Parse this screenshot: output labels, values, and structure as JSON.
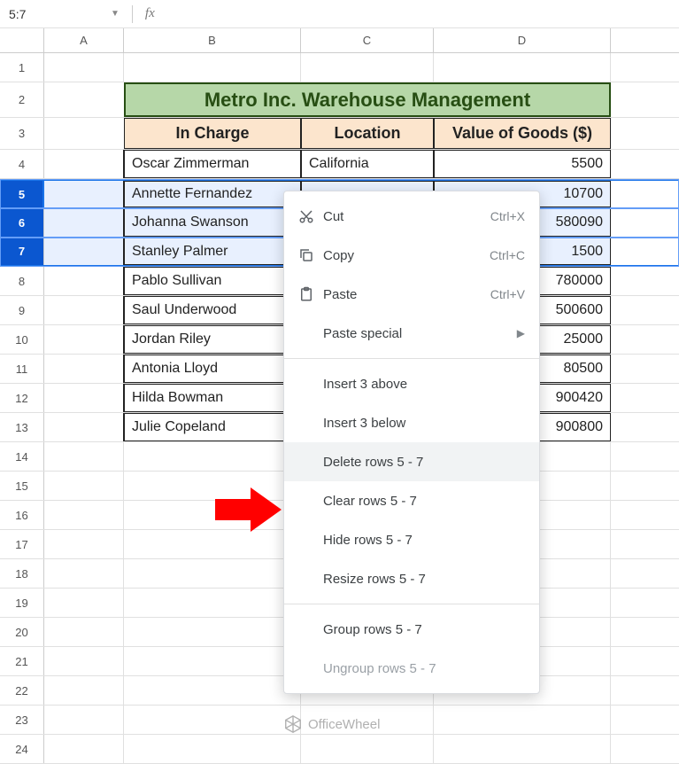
{
  "namebox": {
    "value": "5:7"
  },
  "fx": {
    "label": "fx",
    "value": ""
  },
  "columns": [
    "A",
    "B",
    "C",
    "D"
  ],
  "title": "Metro Inc. Warehouse Management",
  "headers": {
    "in_charge": "In Charge",
    "location": "Location",
    "value_goods": "Value of Goods ($)"
  },
  "rows_visible": 24,
  "selected_rows": [
    5,
    6,
    7
  ],
  "data": [
    {
      "r": 4,
      "name": "Oscar Zimmerman",
      "loc": "California",
      "val": "5500"
    },
    {
      "r": 5,
      "name": "Annette Fernandez",
      "loc": "",
      "val": "10700"
    },
    {
      "r": 6,
      "name": "Johanna Swanson",
      "loc": "",
      "val": "580090"
    },
    {
      "r": 7,
      "name": "Stanley Palmer",
      "loc": "",
      "val": "1500"
    },
    {
      "r": 8,
      "name": "Pablo Sullivan",
      "loc": "",
      "val": "780000"
    },
    {
      "r": 9,
      "name": "Saul Underwood",
      "loc": "",
      "val": "500600"
    },
    {
      "r": 10,
      "name": "Jordan Riley",
      "loc": "",
      "val": "25000"
    },
    {
      "r": 11,
      "name": "Antonia Lloyd",
      "loc": "",
      "val": "80500"
    },
    {
      "r": 12,
      "name": "Hilda Bowman",
      "loc": "",
      "val": "900420"
    },
    {
      "r": 13,
      "name": "Julie Copeland",
      "loc": "",
      "val": "900800"
    }
  ],
  "context_menu": {
    "cut": {
      "label": "Cut",
      "shortcut": "Ctrl+X"
    },
    "copy": {
      "label": "Copy",
      "shortcut": "Ctrl+C"
    },
    "paste": {
      "label": "Paste",
      "shortcut": "Ctrl+V"
    },
    "paste_special": {
      "label": "Paste special"
    },
    "insert_above": {
      "label": "Insert 3 above"
    },
    "insert_below": {
      "label": "Insert 3 below"
    },
    "delete_rows": {
      "label": "Delete rows 5 - 7"
    },
    "clear_rows": {
      "label": "Clear rows 5 - 7"
    },
    "hide_rows": {
      "label": "Hide rows 5 - 7"
    },
    "resize_rows": {
      "label": "Resize rows 5 - 7"
    },
    "group_rows": {
      "label": "Group rows 5 - 7"
    },
    "ungroup_rows": {
      "label": "Ungroup rows 5 - 7"
    }
  },
  "watermark": "OfficeWheel"
}
